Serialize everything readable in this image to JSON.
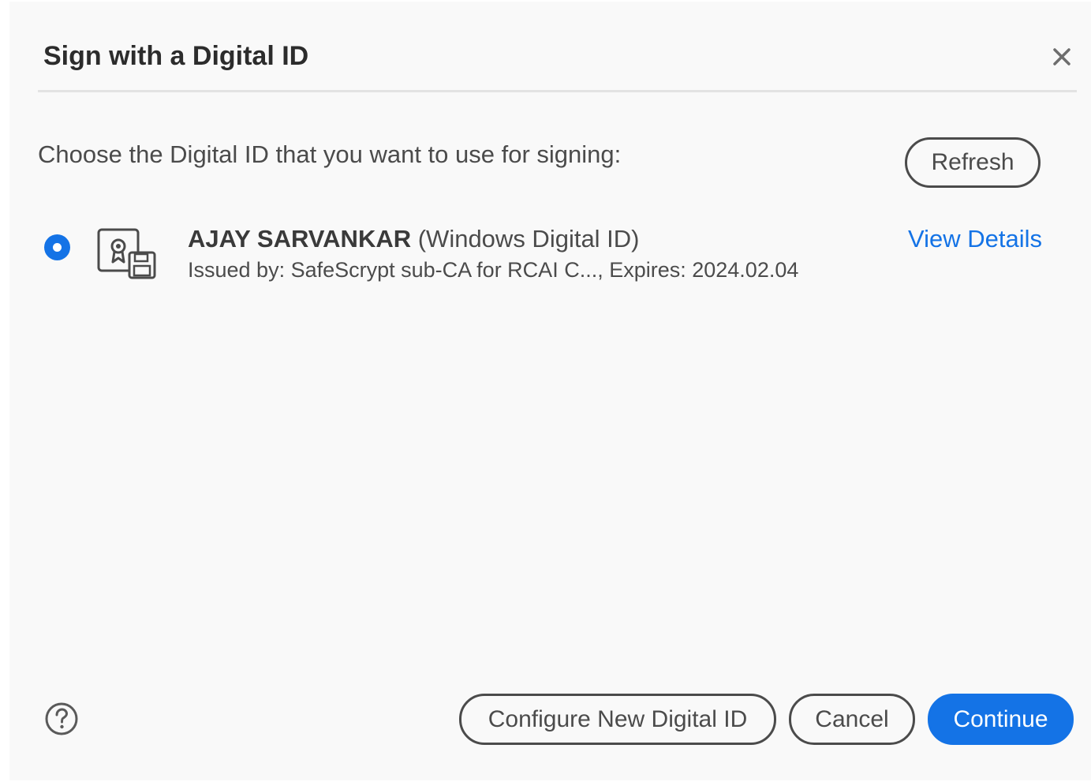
{
  "dialog": {
    "title": "Sign with a Digital ID",
    "close_icon": "close-icon",
    "prompt": "Choose the Digital ID that you want to use for signing:",
    "refresh_label": "Refresh"
  },
  "digital_ids": [
    {
      "selected": true,
      "name": "AJAY SARVANKAR",
      "type": "(Windows Digital ID)",
      "details": "Issued by: SafeScrypt sub-CA for RCAI C..., Expires: 2024.02.04",
      "view_details_label": "View Details",
      "icon": "certificate-icon"
    }
  ],
  "footer": {
    "help_icon": "help-icon",
    "configure_label": "Configure New Digital ID",
    "cancel_label": "Cancel",
    "continue_label": "Continue"
  },
  "colors": {
    "accent": "#1473e6",
    "text": "#4b4b4b",
    "background": "#f9f9f9"
  }
}
